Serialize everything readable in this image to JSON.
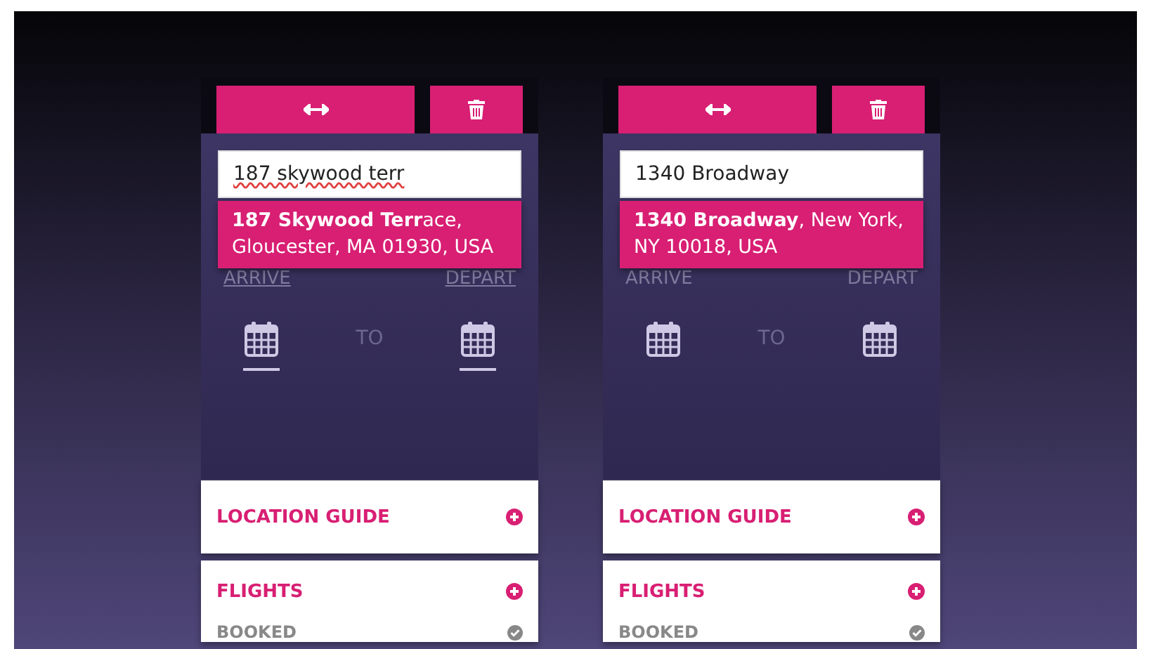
{
  "screens": [
    {
      "address_input": {
        "value": "187 skywood terr",
        "spellcheck_error": true
      },
      "suggestion": "**187 Skywood Terr**ace, Gloucester, MA 01930, USA",
      "arrive_label": "ARRIVE",
      "depart_label": "DEPART",
      "to_label": "TO",
      "dates_underlined": true,
      "sections": [
        {
          "title": "LOCATION GUIDE"
        },
        {
          "title": "FLIGHTS",
          "items": [
            {
              "label": "BOOKED",
              "checked": true
            }
          ]
        }
      ]
    },
    {
      "address_input": {
        "value": "1340 Broadway",
        "spellcheck_error": false
      },
      "suggestion": "**1340 Broadway**, New York, NY 10018, USA",
      "arrive_label": "ARRIVE",
      "depart_label": "DEPART",
      "to_label": "TO",
      "dates_underlined": false,
      "sections": [
        {
          "title": "LOCATION GUIDE"
        },
        {
          "title": "FLIGHTS",
          "items": [
            {
              "label": "BOOKED",
              "checked": true
            }
          ]
        }
      ]
    }
  ]
}
